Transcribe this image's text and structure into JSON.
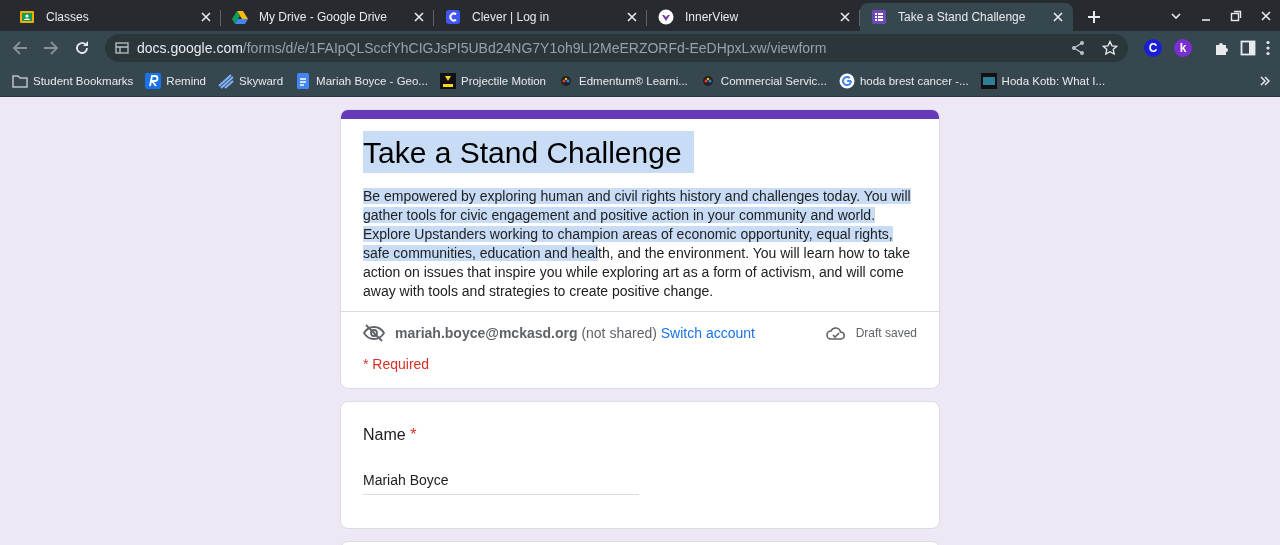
{
  "browser": {
    "tabs": [
      {
        "title": "Classes",
        "selected": false
      },
      {
        "title": "My Drive - Google Drive",
        "selected": false
      },
      {
        "title": "Clever | Log in",
        "selected": false
      },
      {
        "title": "InnerView",
        "selected": false
      },
      {
        "title": "Take a Stand Challenge",
        "selected": true
      }
    ],
    "url": {
      "host": "docs.google.com",
      "path": "/forms/d/e/1FAIpQLSccfYhCIGJsPI5UBd24NG7Y1oh9LI2MeERZORFd-EeDHpxLxw/viewform"
    },
    "extensions": [
      {
        "label": "C",
        "color": "#1a1fd6"
      },
      {
        "label": "k",
        "color": "#7b2fd0"
      }
    ],
    "bookmarks": [
      {
        "title": "Student Bookmarks"
      },
      {
        "title": "Remind"
      },
      {
        "title": "Skyward"
      },
      {
        "title": "Mariah Boyce - Geo..."
      },
      {
        "title": "Projectile Motion"
      },
      {
        "title": "Edmentum® Learni..."
      },
      {
        "title": "Commercial Servic..."
      },
      {
        "title": "hoda brest cancer -..."
      },
      {
        "title": "Hoda Kotb: What I..."
      }
    ]
  },
  "form": {
    "title": "Take a Stand Challenge",
    "title_selected": true,
    "description": {
      "selected": "Be empowered by exploring human and civil rights history and challenges today. You will gather tools for civic engagement and positive action in your community and world. Explore Upstanders working to champion areas of economic opportunity, equal rights, safe communities, education and heal",
      "rest": "th, and the environment. You will learn how to take action on issues that inspire you while exploring art as a form of activism, and will come away with tools and strategies to create positive change."
    },
    "account": {
      "text": "**mariah.boyce@mckasd.org** (not shared)",
      "link": "Switch account",
      "status": "Draft saved"
    },
    "required_note": "* Required",
    "questions": [
      {
        "label": "Name",
        "required_mark": "*",
        "value": "Mariah Boyce"
      }
    ]
  }
}
